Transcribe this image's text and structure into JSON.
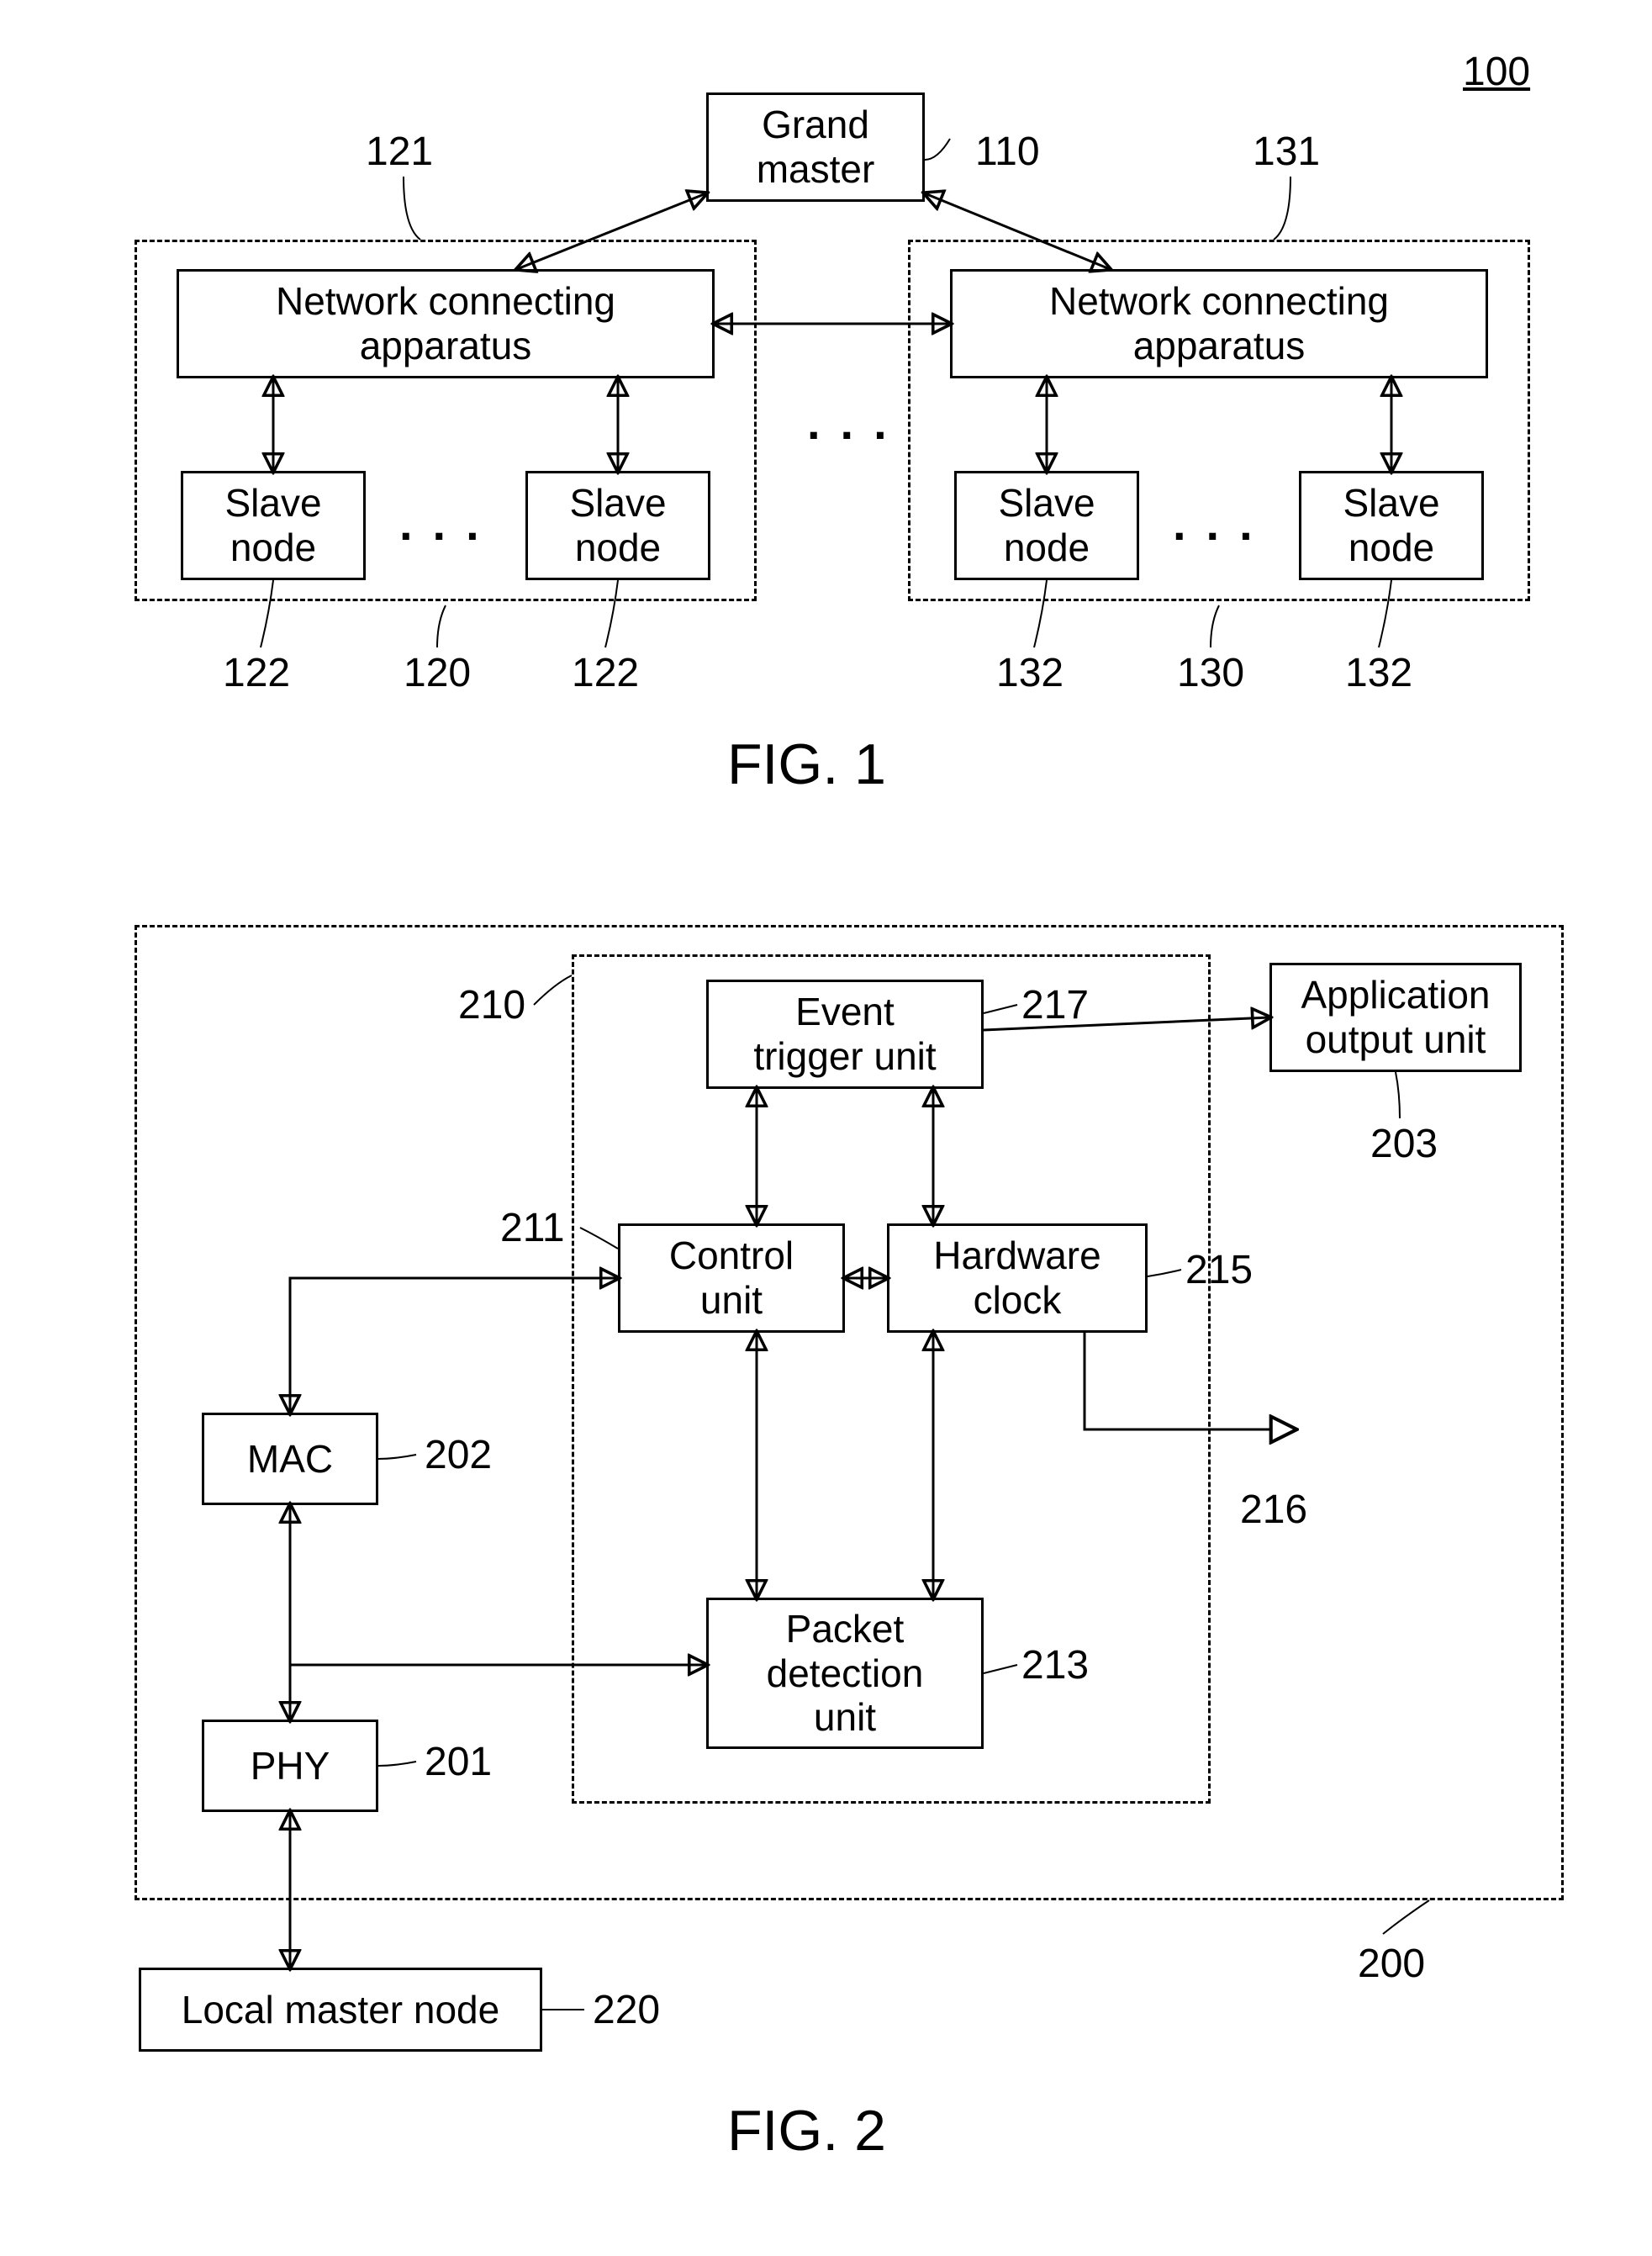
{
  "fig1": {
    "title": "FIG. 1",
    "ref_system": "100",
    "grand_master": "Grand\nmaster",
    "ref_gm": "110",
    "left": {
      "ref_group": "120",
      "ref_nca": "121",
      "ref_slave": "122",
      "nca": "Network connecting\napparatus",
      "slave": "Slave\nnode"
    },
    "right": {
      "ref_group": "130",
      "ref_nca": "131",
      "ref_slave": "132",
      "nca": "Network connecting\napparatus",
      "slave": "Slave\nnode"
    }
  },
  "fig2": {
    "title": "FIG. 2",
    "ref_outer": "200",
    "ref_inner": "210",
    "event_trigger": "Event\ntrigger unit",
    "ref_event": "217",
    "app_output": "Application\noutput unit",
    "ref_app": "203",
    "control": "Control\nunit",
    "ref_ctrl": "211",
    "hwclock": "Hardware\nclock",
    "ref_hw": "215",
    "ref_hw_out": "216",
    "packet": "Packet\ndetection\nunit",
    "ref_pkt": "213",
    "mac": "MAC",
    "ref_mac": "202",
    "phy": "PHY",
    "ref_phy": "201",
    "local_master": "Local master node",
    "ref_lm": "220"
  },
  "chart_data": {
    "type": "diagram",
    "figures": [
      {
        "id": "FIG.1",
        "ref": "100",
        "nodes": [
          {
            "id": "110",
            "label": "Grand master"
          },
          {
            "id": "121",
            "label": "Network connecting apparatus",
            "group": "120"
          },
          {
            "id": "122a",
            "label": "Slave node",
            "group": "120",
            "ref": "122"
          },
          {
            "id": "122b",
            "label": "Slave node",
            "group": "120",
            "ref": "122"
          },
          {
            "id": "131",
            "label": "Network connecting apparatus",
            "group": "130"
          },
          {
            "id": "132a",
            "label": "Slave node",
            "group": "130",
            "ref": "132"
          },
          {
            "id": "132b",
            "label": "Slave node",
            "group": "130",
            "ref": "132"
          }
        ],
        "edges": [
          {
            "from": "110",
            "to": "121",
            "bidir": true
          },
          {
            "from": "110",
            "to": "131",
            "bidir": true
          },
          {
            "from": "121",
            "to": "131",
            "bidir": true
          },
          {
            "from": "121",
            "to": "122a",
            "bidir": true
          },
          {
            "from": "121",
            "to": "122b",
            "bidir": true
          },
          {
            "from": "131",
            "to": "132a",
            "bidir": true
          },
          {
            "from": "131",
            "to": "132b",
            "bidir": true
          }
        ]
      },
      {
        "id": "FIG.2",
        "ref": "200",
        "inner_group_ref": "210",
        "nodes": [
          {
            "id": "217",
            "label": "Event trigger unit"
          },
          {
            "id": "203",
            "label": "Application output unit"
          },
          {
            "id": "211",
            "label": "Control unit"
          },
          {
            "id": "215",
            "label": "Hardware clock"
          },
          {
            "id": "216",
            "label": "(clock output)"
          },
          {
            "id": "213",
            "label": "Packet detection unit"
          },
          {
            "id": "202",
            "label": "MAC"
          },
          {
            "id": "201",
            "label": "PHY"
          },
          {
            "id": "220",
            "label": "Local master node"
          }
        ],
        "edges": [
          {
            "from": "217",
            "to": "203",
            "bidir": false
          },
          {
            "from": "211",
            "to": "217",
            "bidir": true
          },
          {
            "from": "215",
            "to": "217",
            "bidir": true
          },
          {
            "from": "211",
            "to": "215",
            "bidir": true
          },
          {
            "from": "211",
            "to": "213",
            "bidir": true
          },
          {
            "from": "215",
            "to": "213",
            "bidir": true
          },
          {
            "from": "215",
            "to": "216",
            "bidir": false
          },
          {
            "from": "202",
            "to": "211",
            "bidir": true
          },
          {
            "from": "201",
            "to": "213",
            "via": "202-bus",
            "bidir": false
          },
          {
            "from": "201",
            "to": "202",
            "bidir": true
          },
          {
            "from": "220",
            "to": "201",
            "bidir": true
          }
        ]
      }
    ]
  }
}
